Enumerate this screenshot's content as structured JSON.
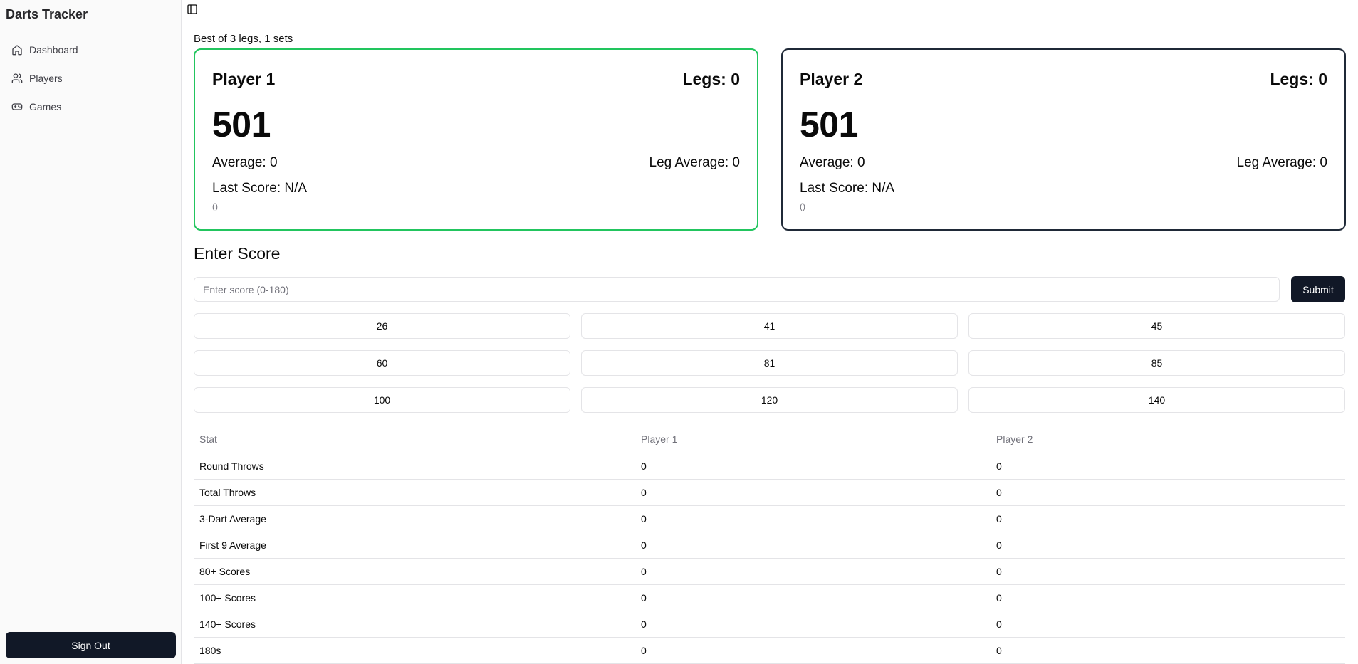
{
  "sidebar": {
    "brand": "Darts Tracker",
    "items": [
      {
        "label": "Dashboard",
        "icon": "home-icon"
      },
      {
        "label": "Players",
        "icon": "users-icon"
      },
      {
        "label": "Games",
        "icon": "gamepad-icon"
      }
    ],
    "sign_out": "Sign Out"
  },
  "header": {
    "toggle_icon": "sidebar-toggle-icon"
  },
  "match": {
    "format": "Best of 3 legs, 1 sets"
  },
  "players": [
    {
      "name": "Player 1",
      "legs": "Legs: 0",
      "score": "501",
      "average": "Average: 0",
      "leg_average": "Leg Average: 0",
      "last_score": "Last Score: N/A",
      "darts": "()",
      "active": true
    },
    {
      "name": "Player 2",
      "legs": "Legs: 0",
      "score": "501",
      "average": "Average: 0",
      "leg_average": "Leg Average: 0",
      "last_score": "Last Score: N/A",
      "darts": "()",
      "active": false
    }
  ],
  "entry": {
    "title": "Enter Score",
    "placeholder": "Enter score (0-180)",
    "value": "",
    "submit": "Submit",
    "quick_scores": [
      "26",
      "41",
      "45",
      "60",
      "81",
      "85",
      "100",
      "120",
      "140"
    ]
  },
  "stats": {
    "headers": [
      "Stat",
      "Player 1",
      "Player 2"
    ],
    "rows": [
      [
        "Round Throws",
        "0",
        "0"
      ],
      [
        "Total Throws",
        "0",
        "0"
      ],
      [
        "3-Dart Average",
        "0",
        "0"
      ],
      [
        "First 9 Average",
        "0",
        "0"
      ],
      [
        "80+ Scores",
        "0",
        "0"
      ],
      [
        "100+ Scores",
        "0",
        "0"
      ],
      [
        "140+ Scores",
        "0",
        "0"
      ],
      [
        "180s",
        "0",
        "0"
      ]
    ]
  },
  "colors": {
    "active_border": "#22c55e",
    "inactive_border": "#1f2937",
    "primary_button": "#111827",
    "sidebar_bg": "#fafafa"
  }
}
